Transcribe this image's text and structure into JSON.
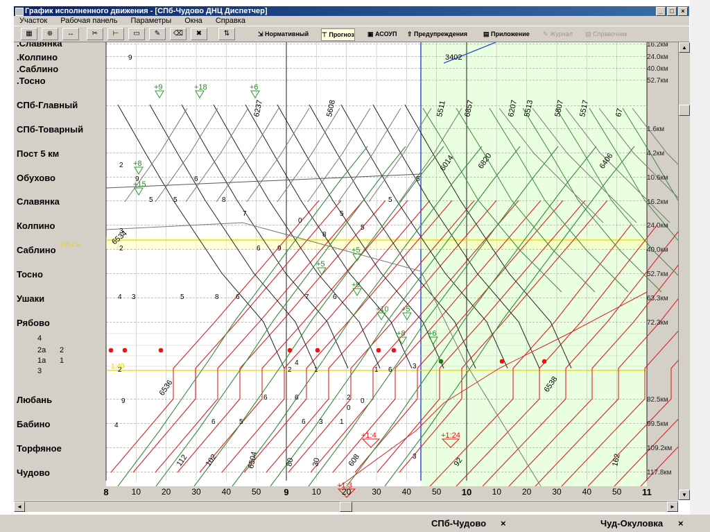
{
  "window": {
    "title": "График исполненного движения - [СПб-Чудово ДНЦ Диспетчер]",
    "controls": [
      "_",
      "□",
      "×"
    ]
  },
  "menu": [
    "Участок",
    "Рабочая панель",
    "Параметры",
    "Окна",
    "Справка"
  ],
  "toolbar": {
    "modes": [
      {
        "label": "Нормативный",
        "state": "normal"
      },
      {
        "label": "Прогноз",
        "state": "active"
      },
      {
        "label": "АСОУП",
        "state": "normal"
      },
      {
        "label": "Предупреждения",
        "state": "normal"
      },
      {
        "label": "Приложение",
        "state": "normal"
      },
      {
        "label": "Журнал",
        "state": "disabled"
      },
      {
        "label": "Справочник",
        "state": "disabled"
      }
    ]
  },
  "stations": [
    {
      "name": ".Славянка",
      "km": "16.2км"
    },
    {
      "name": ".Колпино",
      "km": "24.0км"
    },
    {
      "name": ".Саблино",
      "km": "40.0км"
    },
    {
      "name": ".Тосно",
      "km": "52.7км"
    },
    {
      "name": "СПб-Главный",
      "km": ""
    },
    {
      "name": "СПб-Товарный",
      "km": "1.6км"
    },
    {
      "name": "Пост 5 км",
      "km": "4.2км"
    },
    {
      "name": "Обухово",
      "km": "10.6км"
    },
    {
      "name": "Славянка",
      "km": "16.2км"
    },
    {
      "name": "Колпино",
      "km": "24.0км"
    },
    {
      "name": "Саблино",
      "km": "40.0км"
    },
    {
      "name": "Тосно",
      "km": "52.7км"
    },
    {
      "name": "Ушаки",
      "km": "63.3км"
    },
    {
      "name": "Рябово",
      "km": "72.3км"
    },
    {
      "name": "Любань",
      "km": "82.5км"
    },
    {
      "name": "Бабино",
      "km": "99.5км"
    },
    {
      "name": "Торфяное",
      "km": "109.2км"
    },
    {
      "name": "Чудово",
      "km": "117.8км"
    }
  ],
  "tracks": [
    "4",
    "2а",
    "2",
    "1а",
    "1",
    "3"
  ],
  "time_axis": {
    "labels": [
      "8",
      "10",
      "20",
      "30",
      "40",
      "50",
      "9",
      "10",
      "20",
      "30",
      "40",
      "50",
      "10",
      "10",
      "20",
      "30",
      "40",
      "50",
      "11"
    ],
    "major": [
      "8",
      "9",
      "10",
      "11"
    ]
  },
  "trains": [
    "3402",
    "5511",
    "6857",
    "6207",
    "5513",
    "5807",
    "5517",
    "67",
    "6014",
    "6820",
    "6406",
    "6534",
    "6536",
    "6538",
    "6504",
    "608",
    "112",
    "102",
    "80",
    "30",
    "92",
    "162",
    "6237",
    "5608"
  ],
  "markers": [
    "+9",
    "+18",
    "+6",
    "+8",
    "+15",
    "+5",
    "+9",
    "+10",
    "+5",
    "+8",
    "+6",
    "+1:4",
    "+1:24",
    "+1:3"
  ],
  "statusbar": {
    "tabs": [
      "СПб-Чудово",
      "Чуд-Окуловка"
    ],
    "close": "×"
  },
  "colors": {
    "title_bg": "#0a246a",
    "forecast_bg": "#eaffe0",
    "train_red": "#d22",
    "train_green": "#3a8a3a",
    "train_black": "#222",
    "train_gray": "#777"
  }
}
